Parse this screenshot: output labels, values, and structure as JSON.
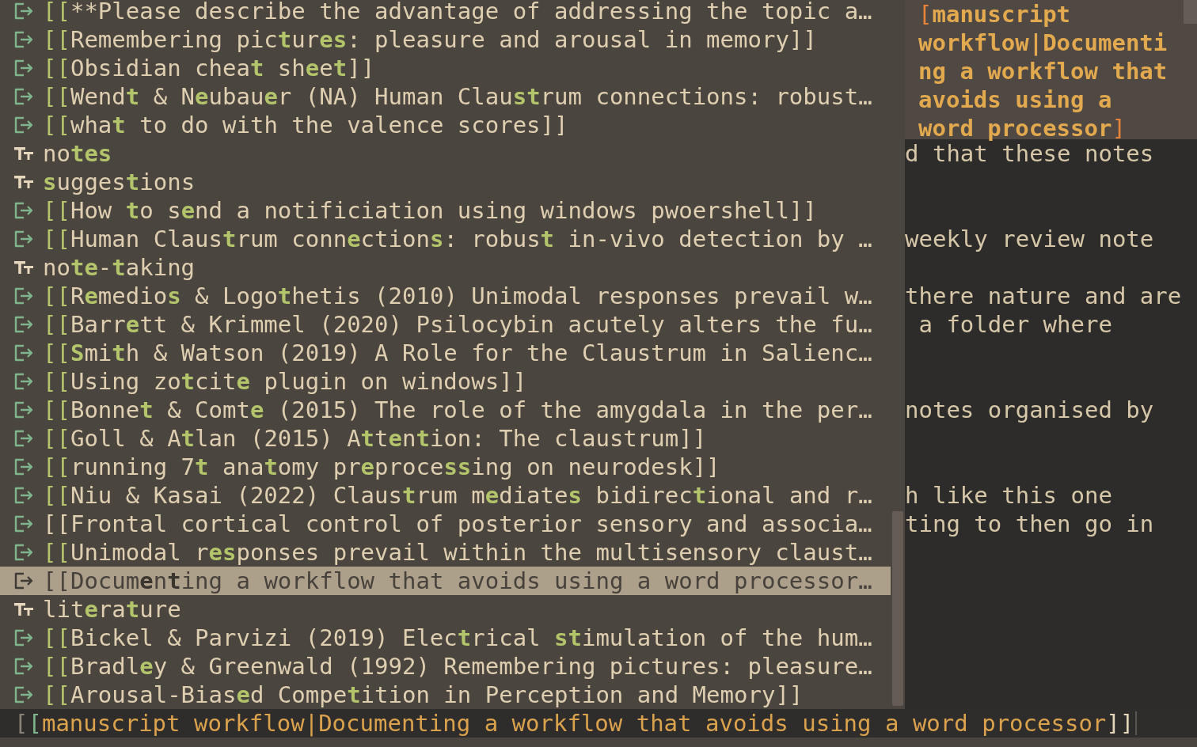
{
  "popup": {
    "items": [
      {
        "kind": "link",
        "prefix": "[[",
        "matched": true,
        "selected": false,
        "label": "**Please describe the advantage of addressing the topic a…"
      },
      {
        "kind": "link",
        "prefix": "[[",
        "matched": true,
        "selected": false,
        "label": "Remembering pic**t**ur**es**: pleasure and arousal in memory]]"
      },
      {
        "kind": "link",
        "prefix": "[[",
        "matched": true,
        "selected": false,
        "label": "Obsidian chea**t** sh**e**e**t**]]"
      },
      {
        "kind": "link",
        "prefix": "[[",
        "matched": true,
        "selected": false,
        "label": "Wend**t** & N**e**ubau**e**r (NA) Human Clau**st**rum connections: robust…"
      },
      {
        "kind": "link",
        "prefix": "[[",
        "matched": true,
        "selected": false,
        "label": "wha**t** to do with the valence scores]]"
      },
      {
        "kind": "tag",
        "selected": false,
        "label": "no**tes**"
      },
      {
        "kind": "tag",
        "selected": false,
        "label": "**s**ugges**t**ions"
      },
      {
        "kind": "link",
        "prefix": "[[",
        "matched": true,
        "selected": false,
        "label": "How **t**o s**e**nd a notificiation using windows pwoershell]]"
      },
      {
        "kind": "link",
        "prefix": "[[",
        "matched": true,
        "selected": false,
        "label": "Human Claus**t**rum conn**e**ction**s**: robus**t** in-vivo detection by …"
      },
      {
        "kind": "tag",
        "selected": false,
        "label": "no**te**-**t**aking"
      },
      {
        "kind": "link",
        "prefix": "[[",
        "matched": true,
        "selected": false,
        "label": "R**e**medio**s** & Logo**t**hetis (2010) Unimodal responses prevail w…"
      },
      {
        "kind": "link",
        "prefix": "[[",
        "matched": true,
        "selected": false,
        "label": "Barr**e**tt & Krimmel (2020) Psilocybin acutely alters the fu…"
      },
      {
        "kind": "link",
        "prefix": "[[",
        "matched": true,
        "selected": false,
        "label": "**S**mi**t**h & Watson (2019) A Role for the Claustrum in Salienc…"
      },
      {
        "kind": "link",
        "prefix": "[[",
        "matched": true,
        "selected": false,
        "label": "Using zo**t**cit**e** plugin on windows]]"
      },
      {
        "kind": "link",
        "prefix": "[[",
        "matched": true,
        "selected": false,
        "label": "Bonne**t** & Comt**e** (2015) The role of the amygdala in the per…"
      },
      {
        "kind": "link",
        "prefix": "[[",
        "matched": true,
        "selected": false,
        "label": "Goll & A**t**lan (2015) A**t**t**e**n**t**ion: The claustrum]]"
      },
      {
        "kind": "link",
        "prefix": "[[",
        "matched": true,
        "selected": false,
        "label": "running 7**t** ana**t**omy pr**e**proce**ss**ing on neurodesk]]"
      },
      {
        "kind": "link",
        "prefix": "[[",
        "matched": true,
        "selected": false,
        "label": "Niu & Kasai (2022) Claus**t**rum m**e**diate**s** bidirec**t**ional and r…"
      },
      {
        "kind": "link",
        "prefix": "[[",
        "matched": false,
        "selected": false,
        "label": "Frontal cortical control of posterior sensory and associa…"
      },
      {
        "kind": "link",
        "prefix": "[[",
        "matched": true,
        "selected": false,
        "label": "Unimodal r**es**ponses prevail within the multisensory claust…"
      },
      {
        "kind": "link",
        "prefix": "[[",
        "matched": true,
        "selected": true,
        "label": "Docum**e**n**t**ing a workflow that avoids using a word processor…"
      },
      {
        "kind": "tag",
        "selected": false,
        "label": "lit**e**ra**t**ure"
      },
      {
        "kind": "link",
        "prefix": "[[",
        "matched": true,
        "selected": false,
        "label": "Bickel & Parvizi (2019) Elec**t**rical **st**imulation of the hum…"
      },
      {
        "kind": "link",
        "prefix": "[[",
        "matched": true,
        "selected": false,
        "label": "Bradl**e**y & Greenwald (1992) Remembering pictures: pleasure…"
      },
      {
        "kind": "link",
        "prefix": "[[",
        "matched": true,
        "selected": false,
        "label": "Arousal-Bias**e**d Compe**t**ition in Perception and Memory]]"
      }
    ]
  },
  "preview": {
    "tooltip": {
      "open": "[",
      "text": "manuscript workflow|Documenting a workflow that avoids using a word processor",
      "close": "]"
    },
    "lines": [
      {
        "text": "d that these notes"
      },
      {
        "text": "weekly review note"
      },
      {
        "text": "there nature and are"
      },
      {
        "text": " a folder where"
      },
      {
        "text": "notes organised by"
      },
      {
        "text": "h like this one"
      },
      {
        "text": "ting to then go in"
      }
    ]
  },
  "input": {
    "parts": [
      {
        "kind": "dim",
        "text": "["
      },
      {
        "kind": "green",
        "text": "["
      },
      {
        "kind": "amber",
        "text": "manuscript workflow|Documenting a workflow that avoids using a word processor"
      },
      {
        "kind": "light",
        "text": "]]"
      }
    ]
  }
}
